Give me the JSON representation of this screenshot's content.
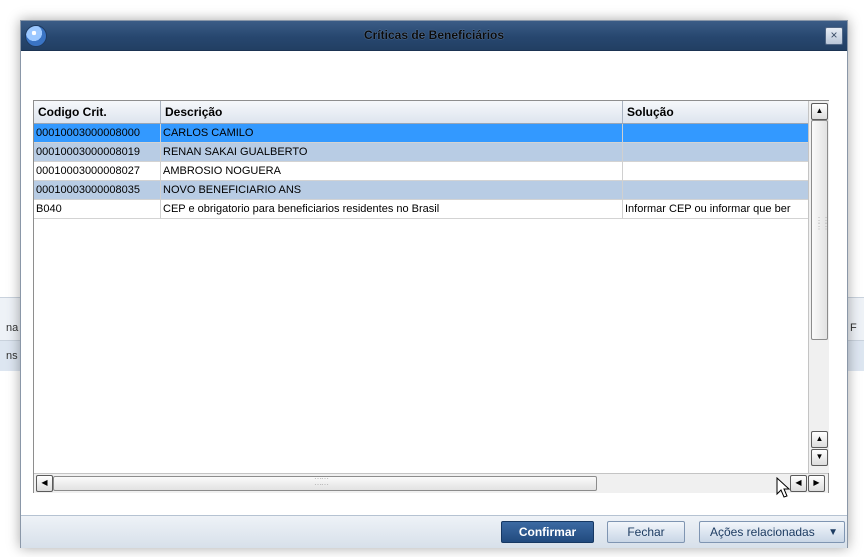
{
  "dialog": {
    "title": "Críticas de Beneficiários",
    "close_glyph": "×"
  },
  "background": {
    "left_snippet_1": "na",
    "left_snippet_2": "ns",
    "right_snippet_1": "F"
  },
  "grid": {
    "columns": [
      "Codigo Crit.",
      "Descrição",
      "Solução"
    ],
    "rows": [
      {
        "code": "00010003000008000",
        "descricao": "CARLOS CAMILO",
        "solucao": ""
      },
      {
        "code": "00010003000008019",
        "descricao": "RENAN SAKAI GUALBERTO",
        "solucao": ""
      },
      {
        "code": "00010003000008027",
        "descricao": "AMBROSIO NOGUERA",
        "solucao": ""
      },
      {
        "code": "00010003000008035",
        "descricao": "NOVO BENEFICIARIO ANS",
        "solucao": ""
      },
      {
        "code": "B040",
        "descricao": "CEP e obrigatorio para beneficiarios residentes no Brasil",
        "solucao": "Informar CEP ou informar que ber"
      }
    ],
    "selected_row": 0
  },
  "footer": {
    "confirm_label": "Confirmar",
    "close_label": "Fechar",
    "related_label": "Ações relacionadas"
  },
  "icons": {
    "app": "app-icon",
    "close": "close-icon",
    "scroll_up": "arrow-up-icon",
    "scroll_down": "arrow-down-icon",
    "scroll_left": "arrow-left-icon",
    "scroll_right": "arrow-right-icon",
    "dropdown": "caret-down-icon",
    "cursor": "mouse-cursor-icon"
  },
  "colors": {
    "title_bar": "#27476f",
    "selected_row": "#3399ff",
    "alt_row": "#b8cce4",
    "primary_button": "#214a7e"
  }
}
